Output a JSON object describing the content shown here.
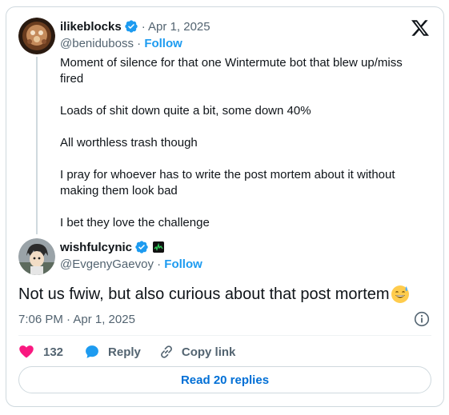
{
  "quoted_tweet": {
    "display_name": "ilikeblocks",
    "date": "· Apr 1, 2025",
    "handle": "@beniduboss",
    "separator": "·",
    "follow_label": "Follow",
    "paragraphs": [
      "Moment of silence for that one Wintermute bot that blew up/miss fired",
      "Loads of shit down quite a bit, some down 40%",
      "All worthless trash though",
      "I pray for whoever has to write the post mortem about it without making them look bad",
      "I bet they love the challenge"
    ]
  },
  "reply_tweet": {
    "display_name": "wishfulcynic",
    "handle": "@EvgenyGaevoy",
    "separator": "·",
    "follow_label": "Follow",
    "text": "Not us fwiw, but also curious about that post mortem",
    "emoji": "sweat-smile-emoji",
    "timestamp": "7:06 PM · Apr 1, 2025"
  },
  "actions": {
    "like_count": "132",
    "reply_label": "Reply",
    "copy_link_label": "Copy link"
  },
  "read_replies_label": "Read 20 replies",
  "colors": {
    "accent": "#1d9bf0",
    "like_red": "#f91880",
    "link_blue": "#006fd6",
    "muted_text": "#536471",
    "border": "#cfd9de"
  },
  "icons": [
    "x-logo-icon",
    "verified-badge-icon",
    "affiliate-badge-icon",
    "info-icon",
    "heart-icon",
    "reply-bubble-icon",
    "link-icon"
  ]
}
